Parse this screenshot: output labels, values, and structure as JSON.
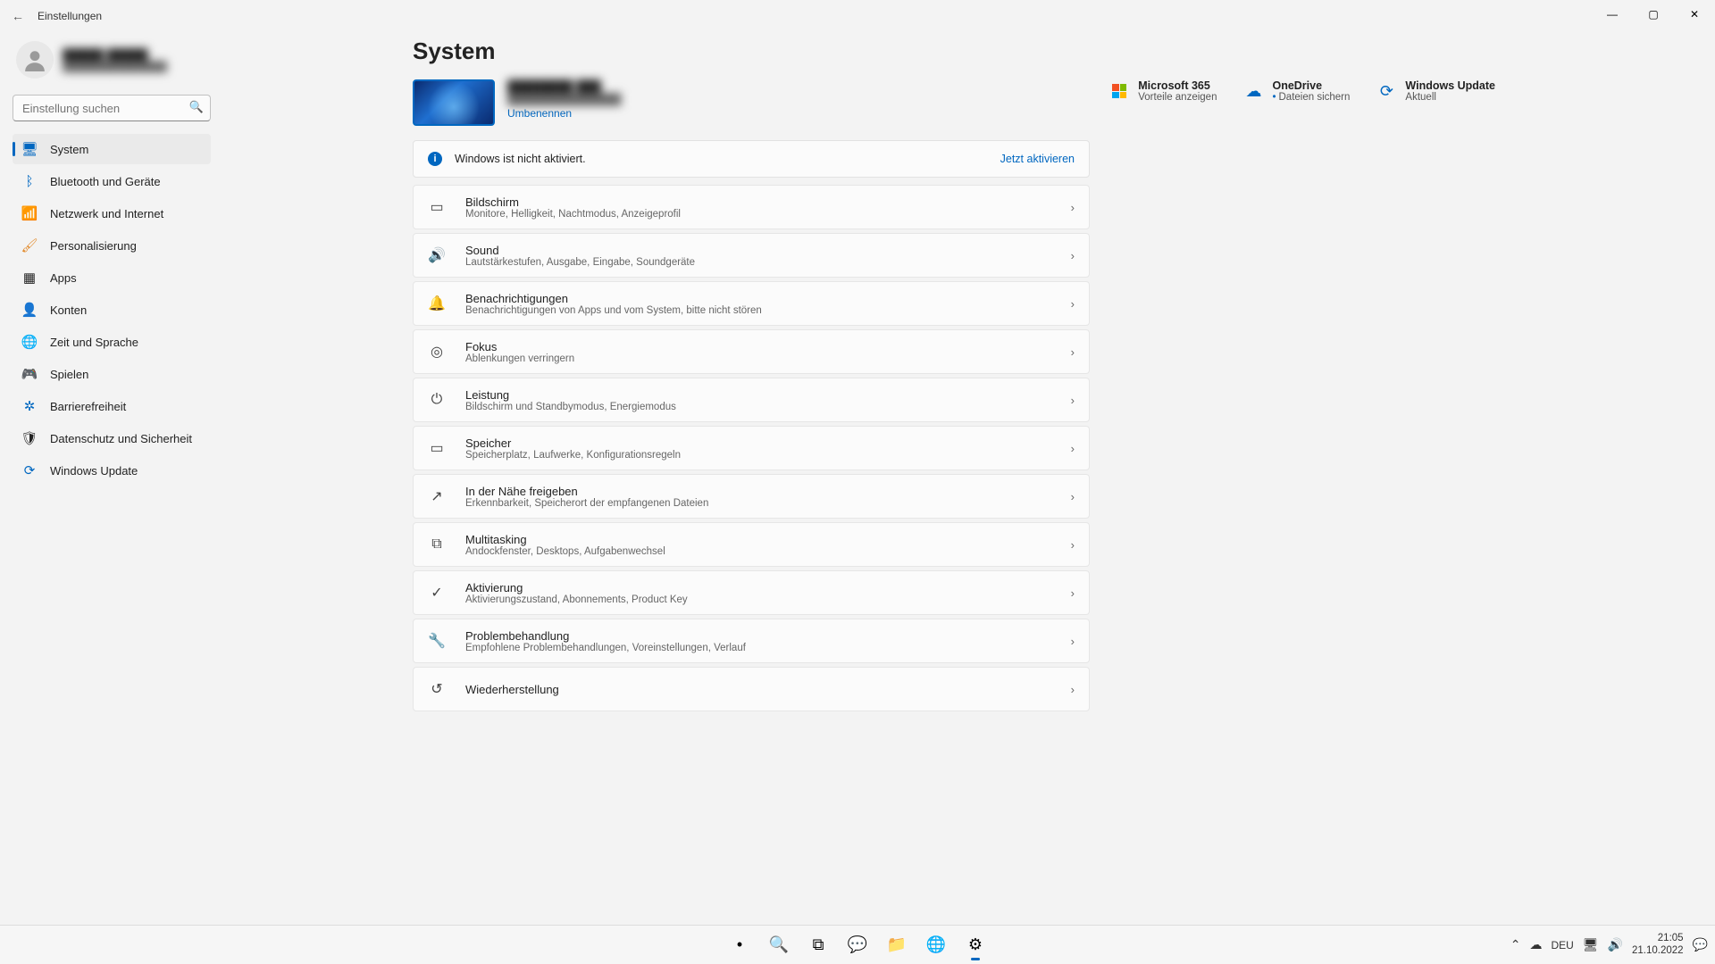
{
  "window": {
    "title": "Einstellungen"
  },
  "profile": {
    "name": "█████ █████",
    "email": "███████████████"
  },
  "search": {
    "placeholder": "Einstellung suchen"
  },
  "nav": [
    {
      "label": "System",
      "icon": "monitor-icon",
      "color": "c-blue",
      "active": true
    },
    {
      "label": "Bluetooth und Geräte",
      "icon": "bluetooth-icon",
      "color": "c-blue"
    },
    {
      "label": "Netzwerk und Internet",
      "icon": "wifi-icon",
      "color": "c-blue"
    },
    {
      "label": "Personalisierung",
      "icon": "brush-icon",
      "color": "c-orange"
    },
    {
      "label": "Apps",
      "icon": "apps-icon",
      "color": ""
    },
    {
      "label": "Konten",
      "icon": "person-icon",
      "color": "c-green"
    },
    {
      "label": "Zeit und Sprache",
      "icon": "globe-icon",
      "color": ""
    },
    {
      "label": "Spielen",
      "icon": "gamepad-icon",
      "color": ""
    },
    {
      "label": "Barrierefreiheit",
      "icon": "accessibility-icon",
      "color": "c-blue"
    },
    {
      "label": "Datenschutz und Sicherheit",
      "icon": "shield-icon",
      "color": ""
    },
    {
      "label": "Windows Update",
      "icon": "update-icon",
      "color": "c-blue"
    }
  ],
  "page": {
    "title": "System",
    "device": {
      "name": "████████ ███",
      "sub": "███████████████",
      "rename": "Umbenennen"
    },
    "tiles": [
      {
        "title": "Microsoft 365",
        "sub": "Vorteile anzeigen",
        "icon": "ms365-icon"
      },
      {
        "title": "OneDrive",
        "sub": "Dateien sichern",
        "dotted": true,
        "icon": "cloud-icon"
      },
      {
        "title": "Windows Update",
        "sub": "Aktuell",
        "icon": "update-icon"
      }
    ],
    "banner": {
      "text": "Windows ist nicht aktiviert.",
      "action": "Jetzt aktivieren"
    },
    "items": [
      {
        "title": "Bildschirm",
        "sub": "Monitore, Helligkeit, Nachtmodus, Anzeigeprofil",
        "icon": "display-icon"
      },
      {
        "title": "Sound",
        "sub": "Lautstärkestufen, Ausgabe, Eingabe, Soundgeräte",
        "icon": "sound-icon"
      },
      {
        "title": "Benachrichtigungen",
        "sub": "Benachrichtigungen von Apps und vom System, bitte nicht stören",
        "icon": "bell-icon"
      },
      {
        "title": "Fokus",
        "sub": "Ablenkungen verringern",
        "icon": "focus-icon"
      },
      {
        "title": "Leistung",
        "sub": "Bildschirm und Standbymodus, Energiemodus",
        "icon": "power-icon"
      },
      {
        "title": "Speicher",
        "sub": "Speicherplatz, Laufwerke, Konfigurationsregeln",
        "icon": "storage-icon"
      },
      {
        "title": "In der Nähe freigeben",
        "sub": "Erkennbarkeit, Speicherort der empfangenen Dateien",
        "icon": "share-icon"
      },
      {
        "title": "Multitasking",
        "sub": "Andockfenster, Desktops, Aufgabenwechsel",
        "icon": "multitask-icon"
      },
      {
        "title": "Aktivierung",
        "sub": "Aktivierungszustand, Abonnements, Product Key",
        "icon": "check-icon"
      },
      {
        "title": "Problembehandlung",
        "sub": "Empfohlene Problembehandlungen, Voreinstellungen, Verlauf",
        "icon": "wrench-icon"
      },
      {
        "title": "Wiederherstellung",
        "sub": "",
        "icon": "recovery-icon"
      }
    ]
  },
  "taskbar": {
    "apps": [
      {
        "name": "start",
        "glyph": "winlogo"
      },
      {
        "name": "search",
        "glyph": "🔍"
      },
      {
        "name": "taskview",
        "glyph": "⧉"
      },
      {
        "name": "chat",
        "glyph": "💬"
      },
      {
        "name": "explorer",
        "glyph": "📁"
      },
      {
        "name": "edge",
        "glyph": "🌐"
      },
      {
        "name": "settings",
        "glyph": "⚙",
        "active": true
      }
    ],
    "tray": {
      "lang": "DEU",
      "time": "21:05",
      "date": "21.10.2022"
    }
  },
  "iconGlyphs": {
    "monitor-icon": "🖥",
    "bluetooth-icon": "ᛒ",
    "wifi-icon": "📶",
    "brush-icon": "🖌",
    "apps-icon": "▦",
    "person-icon": "👤",
    "globe-icon": "🌐",
    "gamepad-icon": "🎮",
    "accessibility-icon": "✲",
    "shield-icon": "🛡",
    "update-icon": "⟳",
    "display-icon": "▭",
    "sound-icon": "🔊",
    "bell-icon": "🔔",
    "focus-icon": "◎",
    "power-icon": "⏻",
    "storage-icon": "▭",
    "share-icon": "↗",
    "multitask-icon": "⧉",
    "check-icon": "✓",
    "wrench-icon": "🔧",
    "recovery-icon": "↺",
    "cloud-icon": "☁",
    "ms365-icon": "ms365"
  }
}
